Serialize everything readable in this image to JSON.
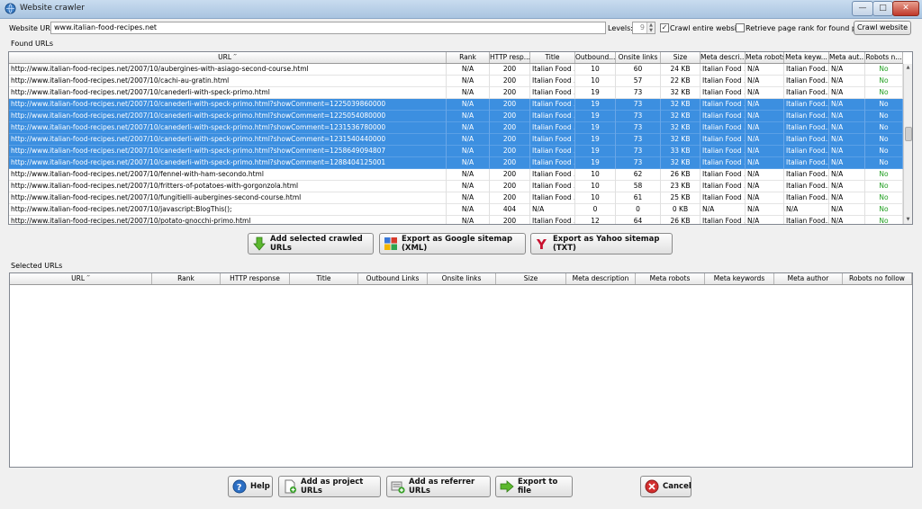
{
  "window": {
    "title": "Website crawler"
  },
  "toolbar": {
    "url_label": "Website URL:",
    "url_value": "www.italian-food-recipes.net",
    "levels_label": "Levels:",
    "levels_value": "9",
    "crawl_entire_label": "Crawl entire website",
    "crawl_entire_checked": true,
    "retrieve_rank_label": "Retrieve page rank for found pages",
    "retrieve_rank_checked": false,
    "crawl_button": "Crawl website"
  },
  "found": {
    "label": "Found URLs",
    "columns": [
      "URL ′′",
      "Rank",
      "HTTP resp...",
      "Title",
      "Outbound...",
      "Onsite links",
      "Size",
      "Meta descri...",
      "Meta robots",
      "Meta keyw...",
      "Meta aut...",
      "Robots n..."
    ],
    "rows": [
      {
        "sel": false,
        "cells": [
          "http://www.italian-food-recipes.net/2007/10/aubergines-with-asiago-second-course.html",
          "N/A",
          "200",
          "Italian Food ...",
          "10",
          "60",
          "24 KB",
          "Italian Food ...",
          "N/A",
          "Italian Food...",
          "N/A",
          "No"
        ]
      },
      {
        "sel": false,
        "cells": [
          "http://www.italian-food-recipes.net/2007/10/cachi-au-gratin.html",
          "N/A",
          "200",
          "Italian Food ...",
          "10",
          "57",
          "22 KB",
          "Italian Food ...",
          "N/A",
          "Italian Food...",
          "N/A",
          "No"
        ]
      },
      {
        "sel": false,
        "cells": [
          "http://www.italian-food-recipes.net/2007/10/canederli-with-speck-primo.html",
          "N/A",
          "200",
          "Italian Food ...",
          "19",
          "73",
          "32 KB",
          "Italian Food ...",
          "N/A",
          "Italian Food...",
          "N/A",
          "No"
        ]
      },
      {
        "sel": true,
        "cells": [
          "http://www.italian-food-recipes.net/2007/10/canederli-with-speck-primo.html?showComment=1225039860000",
          "N/A",
          "200",
          "Italian Food ...",
          "19",
          "73",
          "32 KB",
          "Italian Food ...",
          "N/A",
          "Italian Food...",
          "N/A",
          "No"
        ]
      },
      {
        "sel": true,
        "cells": [
          "http://www.italian-food-recipes.net/2007/10/canederli-with-speck-primo.html?showComment=1225054080000",
          "N/A",
          "200",
          "Italian Food ...",
          "19",
          "73",
          "32 KB",
          "Italian Food ...",
          "N/A",
          "Italian Food...",
          "N/A",
          "No"
        ]
      },
      {
        "sel": true,
        "cells": [
          "http://www.italian-food-recipes.net/2007/10/canederli-with-speck-primo.html?showComment=1231536780000",
          "N/A",
          "200",
          "Italian Food ...",
          "19",
          "73",
          "32 KB",
          "Italian Food ...",
          "N/A",
          "Italian Food...",
          "N/A",
          "No"
        ]
      },
      {
        "sel": true,
        "cells": [
          "http://www.italian-food-recipes.net/2007/10/canederli-with-speck-primo.html?showComment=1231540440000",
          "N/A",
          "200",
          "Italian Food ...",
          "19",
          "73",
          "32 KB",
          "Italian Food ...",
          "N/A",
          "Italian Food...",
          "N/A",
          "No"
        ]
      },
      {
        "sel": true,
        "cells": [
          "http://www.italian-food-recipes.net/2007/10/canederli-with-speck-primo.html?showComment=1258649094807",
          "N/A",
          "200",
          "Italian Food ...",
          "19",
          "73",
          "33 KB",
          "Italian Food ...",
          "N/A",
          "Italian Food...",
          "N/A",
          "No"
        ]
      },
      {
        "sel": true,
        "cells": [
          "http://www.italian-food-recipes.net/2007/10/canederli-with-speck-primo.html?showComment=1288404125001",
          "N/A",
          "200",
          "Italian Food ...",
          "19",
          "73",
          "32 KB",
          "Italian Food ...",
          "N/A",
          "Italian Food...",
          "N/A",
          "No"
        ]
      },
      {
        "sel": false,
        "cells": [
          "http://www.italian-food-recipes.net/2007/10/fennel-with-ham-secondo.html",
          "N/A",
          "200",
          "Italian Food ...",
          "10",
          "62",
          "26 KB",
          "Italian Food ...",
          "N/A",
          "Italian Food...",
          "N/A",
          "No"
        ]
      },
      {
        "sel": false,
        "cells": [
          "http://www.italian-food-recipes.net/2007/10/fritters-of-potatoes-with-gorgonzola.html",
          "N/A",
          "200",
          "Italian Food ...",
          "10",
          "58",
          "23 KB",
          "Italian Food ...",
          "N/A",
          "Italian Food...",
          "N/A",
          "No"
        ]
      },
      {
        "sel": false,
        "cells": [
          "http://www.italian-food-recipes.net/2007/10/fungitielli-aubergines-second-course.html",
          "N/A",
          "200",
          "Italian Food ...",
          "10",
          "61",
          "25 KB",
          "Italian Food ...",
          "N/A",
          "Italian Food...",
          "N/A",
          "No"
        ]
      },
      {
        "sel": false,
        "cells": [
          "http://www.italian-food-recipes.net/2007/10/javascript:BlogThis();",
          "N/A",
          "404",
          "N/A",
          "0",
          "0",
          "0 KB",
          "N/A",
          "N/A",
          "N/A",
          "N/A",
          "No"
        ]
      },
      {
        "sel": false,
        "cells": [
          "http://www.italian-food-recipes.net/2007/10/potato-gnocchi-primo.html",
          "N/A",
          "200",
          "Italian Food ...",
          "12",
          "64",
          "26 KB",
          "Italian Food ...",
          "N/A",
          "Italian Food...",
          "N/A",
          "No"
        ]
      }
    ]
  },
  "actions": {
    "add_selected": "Add selected crawled URLs",
    "export_google": "Export as Google sitemap (XML)",
    "export_yahoo": "Export as Yahoo sitemap (TXT)"
  },
  "selected": {
    "label": "Selected URLs",
    "columns": [
      "URL ′′",
      "Rank",
      "HTTP response",
      "Title",
      "Outbound Links",
      "Onsite links",
      "Size",
      "Meta description",
      "Meta robots",
      "Meta keywords",
      "Meta author",
      "Robots no follow"
    ]
  },
  "footer": {
    "help": "Help",
    "add_project": "Add as project URLs",
    "add_referrer": "Add as referrer URLs",
    "export_file": "Export to file",
    "cancel": "Cancel"
  },
  "colors": {
    "selection": "#3c8fe0",
    "robots_no": "#1e9e1e"
  }
}
